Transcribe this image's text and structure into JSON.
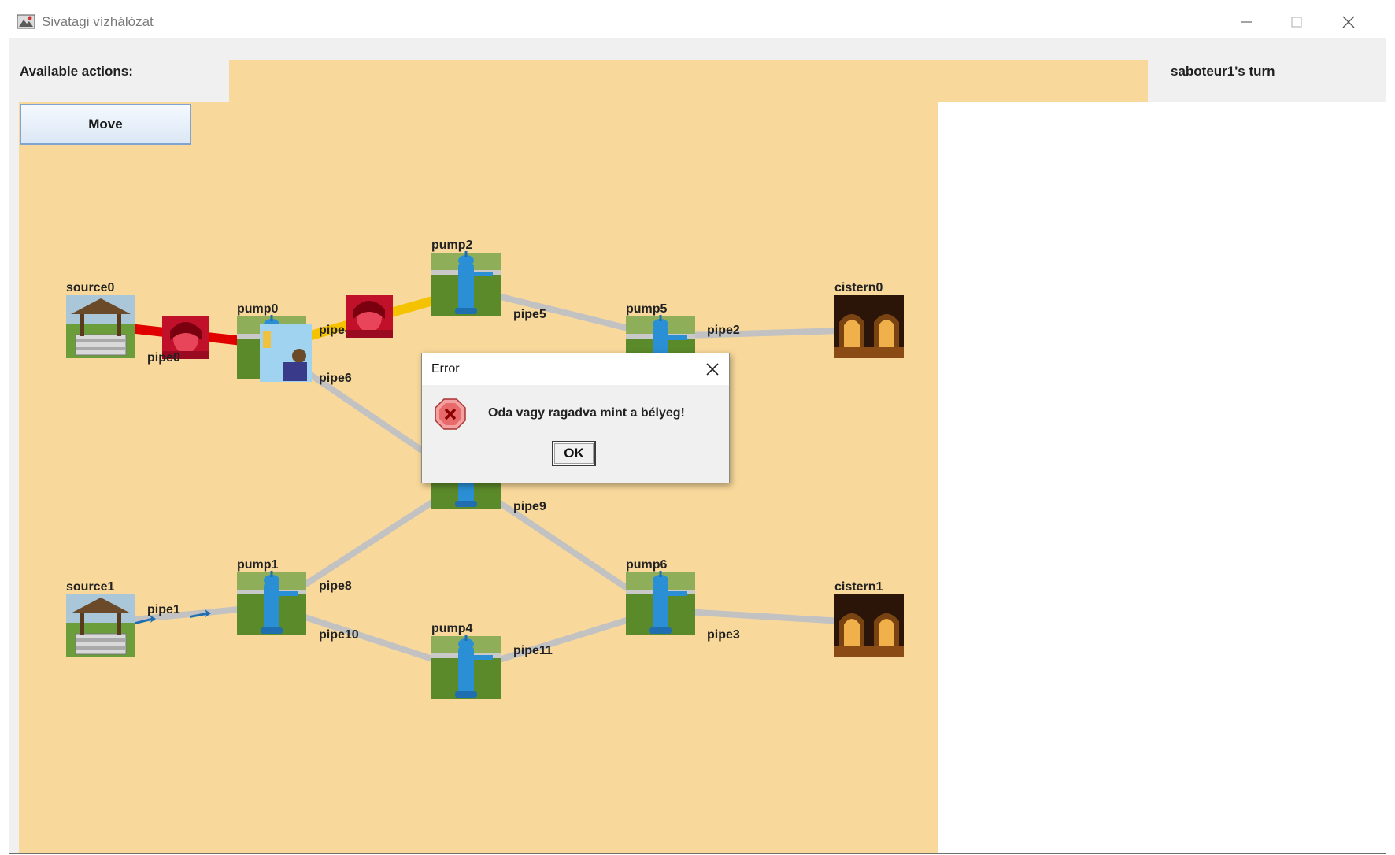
{
  "window": {
    "title": "Sivatagi vízhálózat",
    "controls": [
      "minimize-icon",
      "maximize-icon",
      "close-icon"
    ]
  },
  "panel": {
    "actions_label": "Available actions:",
    "move_button": "Move",
    "turn_label": "saboteur1's turn"
  },
  "map": {
    "background": "#f9d99b",
    "nodes": {
      "source0": "source0",
      "source1": "source1",
      "pump0": "pump0",
      "pump1": "pump1",
      "pump2": "pump2",
      "pump4": "pump4",
      "pump5": "pump5",
      "pump6": "pump6",
      "cistern0": "cistern0",
      "cistern1": "cistern1"
    },
    "pipes": {
      "pipe0": "pipe0",
      "pipe1": "pipe1",
      "pipe2": "pipe2",
      "pipe3": "pipe3",
      "pipe4": "pipe4",
      "pipe5": "pipe5",
      "pipe6": "pipe6",
      "pipe8": "pipe8",
      "pipe9": "pipe9",
      "pipe10": "pipe10",
      "pipe11": "pipe11"
    },
    "pipe_colors": {
      "normal": "#c2c2c2",
      "leaking": "#e00000",
      "sticky": "#f5c200"
    }
  },
  "dialog": {
    "title": "Error",
    "message": "Oda vagy ragadva mint a bélyeg!",
    "ok_label": "OK",
    "icon": "error-icon"
  }
}
